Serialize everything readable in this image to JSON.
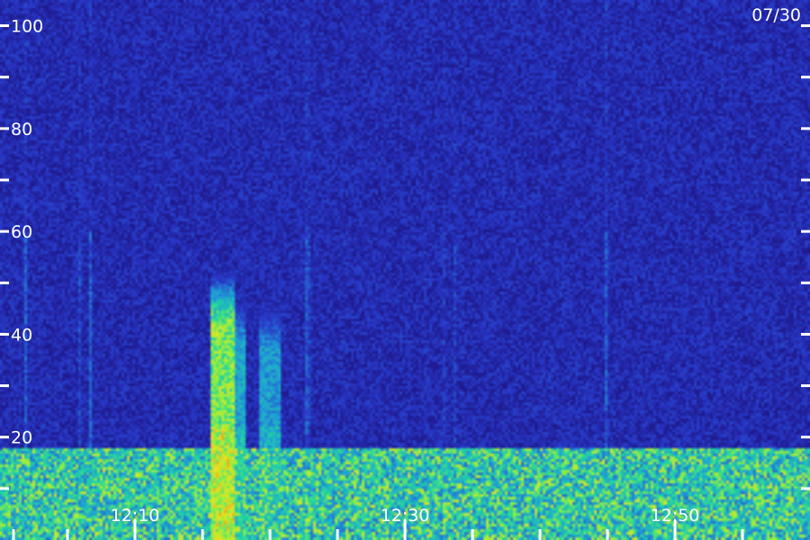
{
  "chart_data": {
    "type": "heatmap",
    "title": "",
    "xlabel": "",
    "ylabel": "",
    "date_label": "07/30",
    "x_ticks": [
      {
        "label": "12:10",
        "value": 10
      },
      {
        "label": "12:30",
        "value": 30
      },
      {
        "label": "12:50",
        "value": 50
      }
    ],
    "x_minor_ticks": [
      1,
      5,
      10,
      15,
      20,
      25,
      30,
      35,
      40,
      45,
      50,
      55
    ],
    "xlim": [
      0,
      60
    ],
    "y_ticks": [
      20,
      40,
      60,
      80,
      100
    ],
    "y_minor_ticks": [
      10,
      30,
      50,
      70,
      90
    ],
    "ylim": [
      0,
      105
    ],
    "colorscale": [
      "#1a0a6e",
      "#2838c8",
      "#1f9cd8",
      "#22d6a0",
      "#9cf03a",
      "#f0e020",
      "#e85010"
    ],
    "background_level": 0.12,
    "events": [
      {
        "x_start": 15.7,
        "x_end": 17.3,
        "y_top": 54,
        "intensity": 0.78
      },
      {
        "x_start": 17.3,
        "x_end": 18.2,
        "y_top": 50,
        "intensity": 0.45
      },
      {
        "x_start": 19.2,
        "x_end": 20.7,
        "y_top": 49,
        "intensity": 0.42
      }
    ],
    "noise_band": {
      "y_bottom": 0,
      "y_top": 18,
      "intensity": 0.55
    }
  }
}
